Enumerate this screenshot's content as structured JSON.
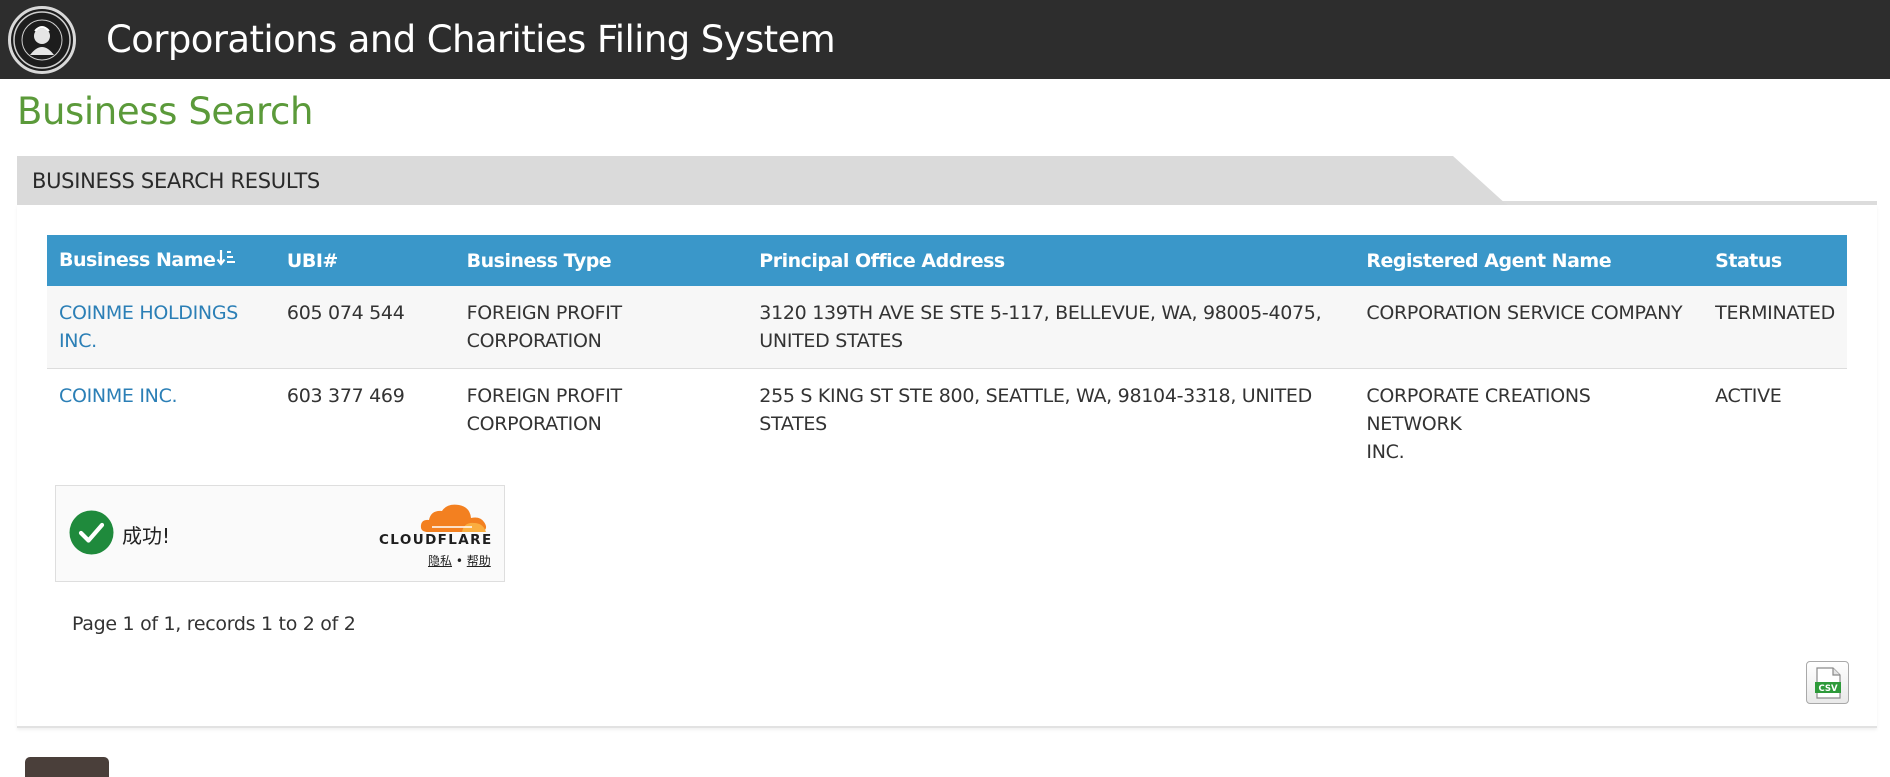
{
  "header": {
    "app_title": "Corporations and Charities Filing System",
    "logo_icon": "state-seal-icon"
  },
  "page": {
    "title": "Business Search"
  },
  "section": {
    "title": "BUSINESS SEARCH RESULTS"
  },
  "table": {
    "columns": [
      "Business Name",
      "UBI#",
      "Business Type",
      "Principal Office Address",
      "Registered Agent Name",
      "Status"
    ],
    "sort_icon": "sort-alpha-down-icon",
    "rows": [
      {
        "name_line1": "COINME HOLDINGS",
        "name_line2": "INC.",
        "ubi": "605 074 544",
        "type_line1": "FOREIGN PROFIT",
        "type_line2": "CORPORATION",
        "address_line1": "3120 139TH AVE SE STE 5-117, BELLEVUE, WA, 98005-4075,",
        "address_line2": "UNITED STATES",
        "agent_line1": "CORPORATION SERVICE COMPANY",
        "agent_line2": "",
        "status": "TERMINATED"
      },
      {
        "name_line1": "COINME INC.",
        "name_line2": "",
        "ubi": "603 377 469",
        "type_line1": "FOREIGN PROFIT",
        "type_line2": "CORPORATION",
        "address_line1": "255 S KING ST STE 800, SEATTLE, WA, 98104-3318, UNITED",
        "address_line2": "STATES",
        "agent_line1": "CORPORATE CREATIONS NETWORK",
        "agent_line2": "INC.",
        "status": "ACTIVE"
      }
    ]
  },
  "captcha": {
    "success_text": "成功!",
    "brand": "CLOUDFLARE",
    "privacy_link": "隐私",
    "separator": "•",
    "help_link": "帮助"
  },
  "pager": {
    "text": "Page 1 of 1, records 1 to 2 of 2"
  },
  "export": {
    "icon": "csv-file-icon",
    "csv_label": "CSV"
  },
  "colors": {
    "header_bg": "#2d2d2d",
    "title_green": "#5b9a3a",
    "table_header_blue": "#3a97c9",
    "link_blue": "#2b7fb6",
    "cloudflare_orange": "#f38020",
    "success_green": "#1f8a3c"
  }
}
